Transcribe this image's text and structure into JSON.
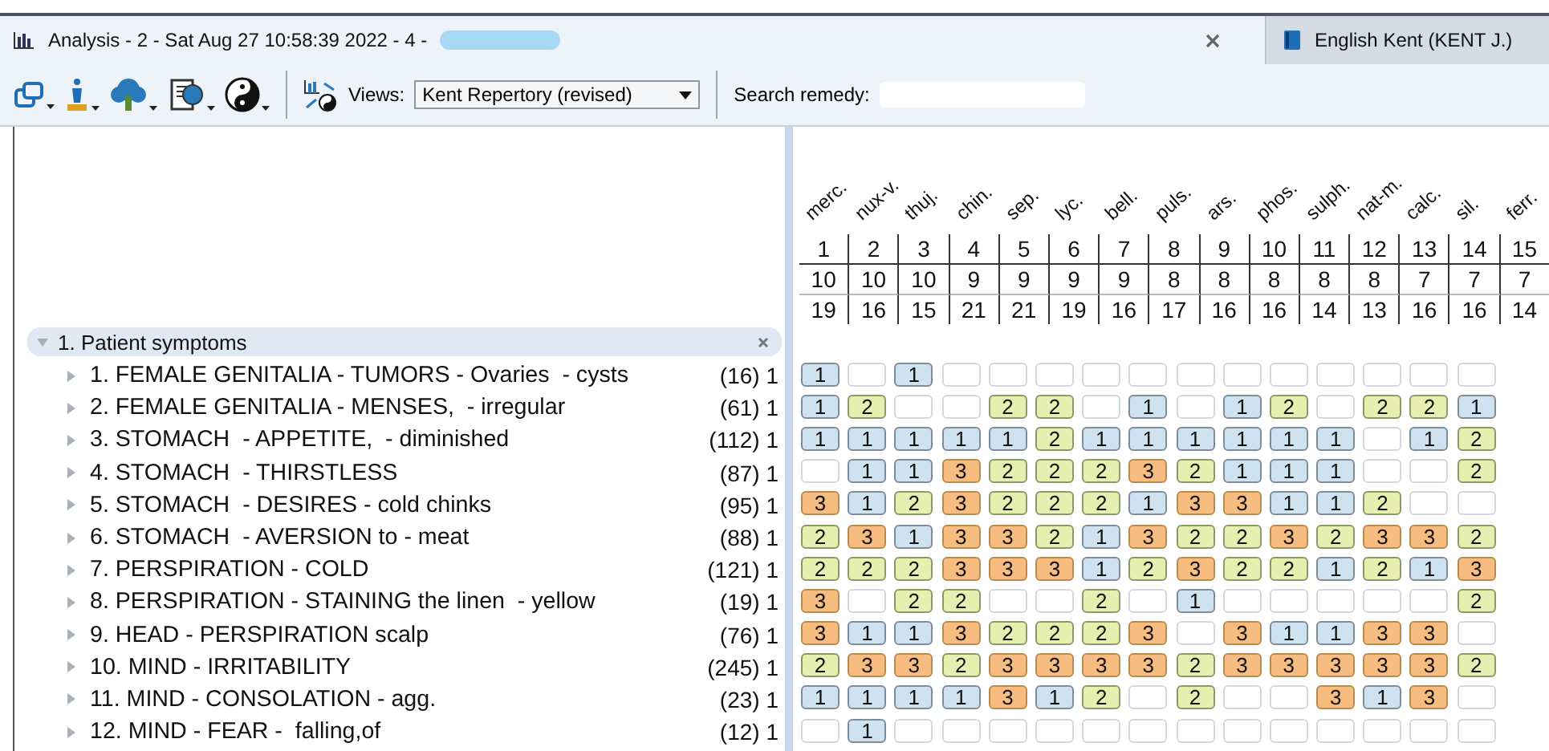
{
  "tabs": [
    {
      "label": "Analysis - 2 - Sat Aug 27 10:58:39 2022 - 4 -",
      "selected": true,
      "kind": "analysis"
    },
    {
      "label": "English Kent (KENT J.)",
      "selected": false,
      "kind": "book"
    }
  ],
  "toolbar": {
    "views_label": "Views:",
    "views_value": "Kent Repertory (revised)",
    "search_label": "Search remedy:"
  },
  "remedies": [
    {
      "name": "merc.",
      "rank": "1",
      "count": "10",
      "score": "19"
    },
    {
      "name": "nux-v.",
      "rank": "2",
      "count": "10",
      "score": "16"
    },
    {
      "name": "thuj.",
      "rank": "3",
      "count": "10",
      "score": "15"
    },
    {
      "name": "chin.",
      "rank": "4",
      "count": "9",
      "score": "21"
    },
    {
      "name": "sep.",
      "rank": "5",
      "count": "9",
      "score": "21"
    },
    {
      "name": "lyc.",
      "rank": "6",
      "count": "9",
      "score": "19"
    },
    {
      "name": "bell.",
      "rank": "7",
      "count": "9",
      "score": "16"
    },
    {
      "name": "puls.",
      "rank": "8",
      "count": "8",
      "score": "17"
    },
    {
      "name": "ars.",
      "rank": "9",
      "count": "8",
      "score": "16"
    },
    {
      "name": "phos.",
      "rank": "10",
      "count": "8",
      "score": "16"
    },
    {
      "name": "sulph.",
      "rank": "11",
      "count": "8",
      "score": "14"
    },
    {
      "name": "nat-m.",
      "rank": "12",
      "count": "8",
      "score": "13"
    },
    {
      "name": "calc.",
      "rank": "13",
      "count": "7",
      "score": "16"
    },
    {
      "name": "sil.",
      "rank": "14",
      "count": "7",
      "score": "16"
    },
    {
      "name": "ferr.",
      "rank": "15",
      "count": "7",
      "score": "14"
    }
  ],
  "group": {
    "label": "1. Patient symptoms",
    "expanded": true
  },
  "symptoms": [
    {
      "label": "1. FEMALE GENITALIA - TUMORS - Ovaries  - cysts",
      "count": "(16) 1",
      "expanded": false,
      "cells": [
        "1",
        null,
        "1",
        null,
        null,
        null,
        null,
        null,
        null,
        null,
        null,
        null,
        null,
        null,
        null
      ]
    },
    {
      "label": "2. FEMALE GENITALIA - MENSES,  - irregular",
      "count": "(61) 1",
      "expanded": false,
      "cells": [
        "1",
        "2",
        null,
        null,
        "2",
        "2",
        null,
        "1",
        null,
        "1",
        "2",
        null,
        "2",
        "2",
        "1"
      ]
    },
    {
      "label": "3. STOMACH  - APPETITE,  - diminished",
      "count": "(112) 1",
      "expanded": false,
      "cells": [
        "1",
        "1",
        "1",
        "1",
        "1",
        "2",
        "1",
        "1",
        "1",
        "1",
        "1",
        "1",
        null,
        "1",
        "2"
      ]
    },
    {
      "label": "4. STOMACH  - THIRSTLESS",
      "count": "(87) 1",
      "expanded": false,
      "cells": [
        null,
        "1",
        "1",
        "3",
        "2",
        "2",
        "2",
        "3",
        "2",
        "1",
        "1",
        "1",
        null,
        null,
        "2"
      ]
    },
    {
      "label": "5. STOMACH  - DESIRES - cold chinks",
      "count": "(95) 1",
      "expanded": false,
      "cells": [
        "3",
        "1",
        "2",
        "3",
        "2",
        "2",
        "2",
        "1",
        "3",
        "3",
        "1",
        "1",
        "2",
        null,
        null
      ]
    },
    {
      "label": "6. STOMACH  - AVERSION to - meat",
      "count": "(88) 1",
      "expanded": false,
      "cells": [
        "2",
        "3",
        "1",
        "3",
        "3",
        "2",
        "1",
        "3",
        "2",
        "2",
        "3",
        "2",
        "3",
        "3",
        "2"
      ]
    },
    {
      "label": "7. PERSPIRATION - COLD",
      "count": "(121) 1",
      "expanded": false,
      "cells": [
        "2",
        "2",
        "2",
        "3",
        "3",
        "3",
        "1",
        "2",
        "3",
        "2",
        "2",
        "1",
        "2",
        "1",
        "3"
      ]
    },
    {
      "label": "8. PERSPIRATION - STAINING the linen  - yellow",
      "count": "(19) 1",
      "expanded": false,
      "cells": [
        "3",
        null,
        "2",
        "2",
        null,
        null,
        "2",
        null,
        "1",
        null,
        null,
        null,
        null,
        null,
        "2"
      ]
    },
    {
      "label": "9. HEAD - PERSPIRATION scalp",
      "count": "(76) 1",
      "expanded": false,
      "cells": [
        "3",
        "1",
        "1",
        "3",
        "2",
        "2",
        "2",
        "3",
        null,
        "3",
        "1",
        "1",
        "3",
        "3",
        null
      ]
    },
    {
      "label": "10. MIND - IRRITABILITY",
      "count": "(245) 1",
      "expanded": false,
      "cells": [
        "2",
        "3",
        "3",
        "2",
        "3",
        "3",
        "3",
        "3",
        "2",
        "3",
        "3",
        "3",
        "3",
        "3",
        "2"
      ]
    },
    {
      "label": "11. MIND - CONSOLATION - agg.",
      "count": "(23) 1",
      "expanded": false,
      "cells": [
        "1",
        "1",
        "1",
        "1",
        "3",
        "1",
        "2",
        null,
        "2",
        null,
        null,
        "3",
        "1",
        "3",
        null
      ]
    },
    {
      "label": "12. MIND - FEAR -  falling,of",
      "count": "(12) 1",
      "expanded": false,
      "cells": [
        null,
        "1",
        null,
        null,
        null,
        null,
        null,
        null,
        null,
        null,
        null,
        null,
        null,
        null,
        null
      ]
    }
  ]
}
